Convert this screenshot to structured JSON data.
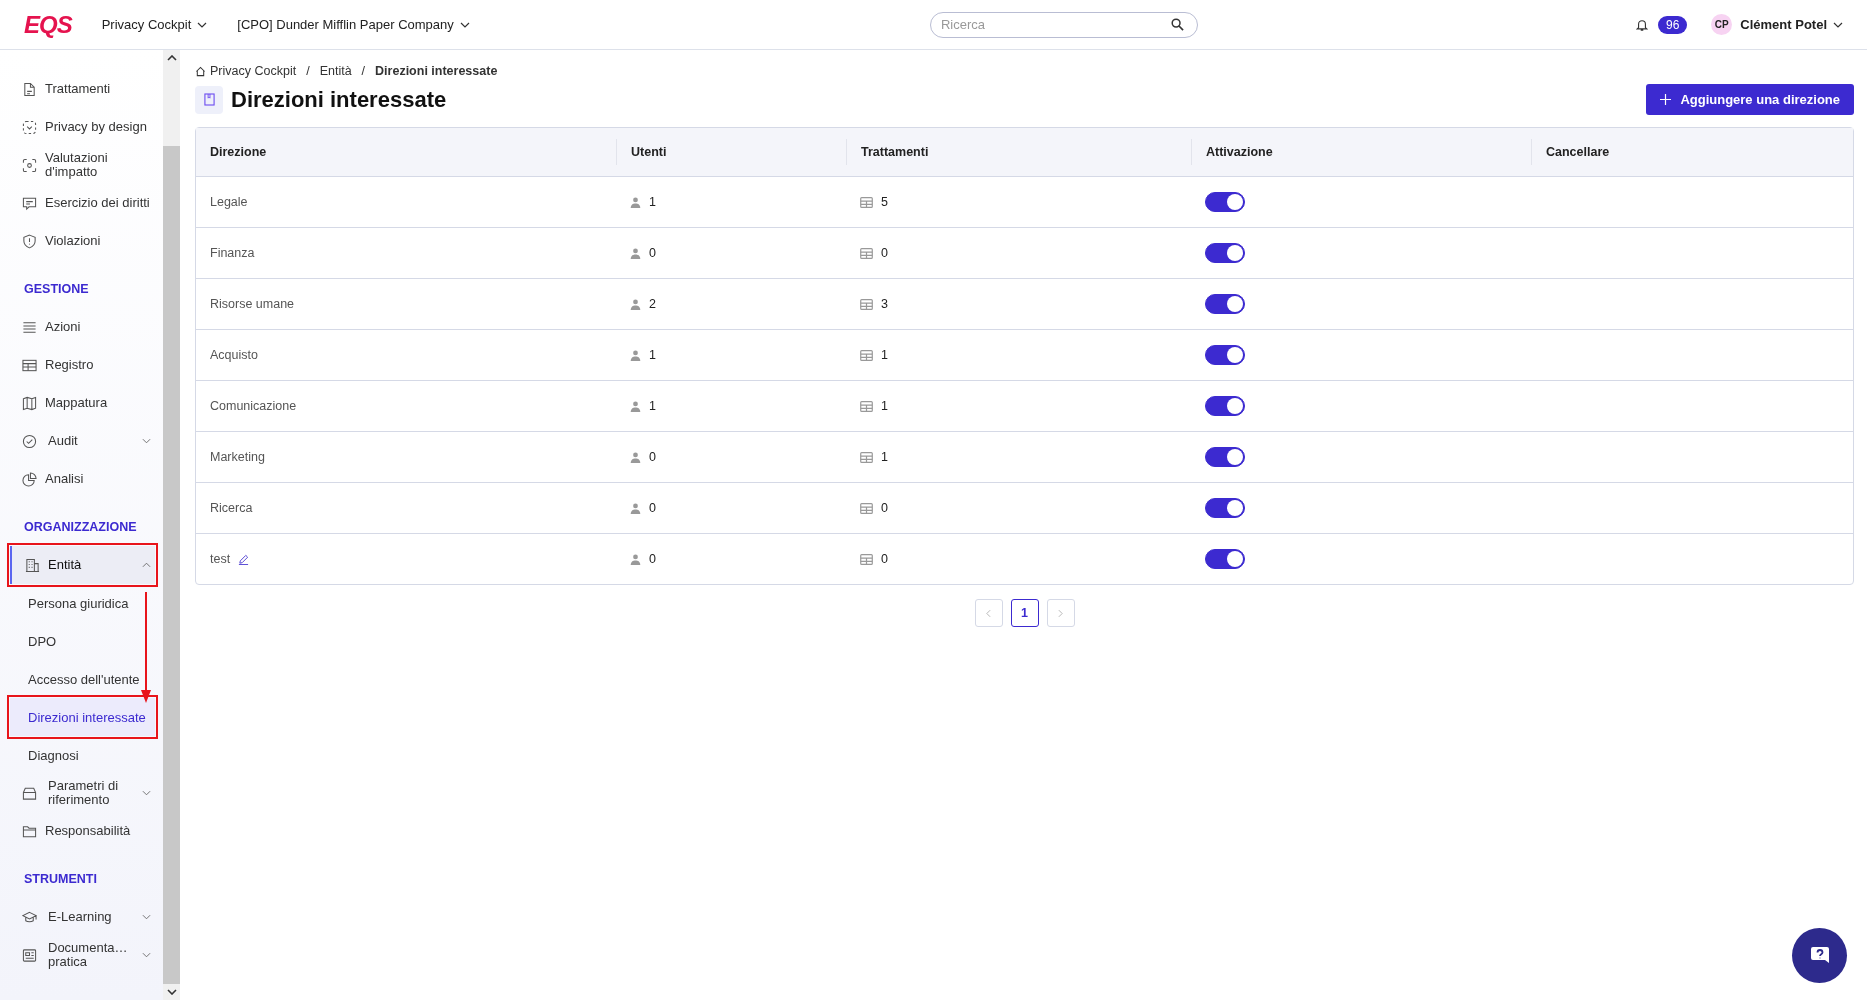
{
  "topbar": {
    "logo": "EQS",
    "menus": [
      {
        "label": "Privacy Cockpit"
      },
      {
        "label": "[CPO] Dunder Mifflin Paper Company"
      }
    ],
    "search": {
      "placeholder": "Ricerca"
    },
    "notifications": "96",
    "user": {
      "initials": "CP",
      "name": "Clément Potel"
    }
  },
  "sidebar": {
    "sections": [
      {
        "items": [
          {
            "label": "Trattamenti",
            "selected": false
          },
          {
            "label": "Privacy by design",
            "selected": false
          },
          {
            "label": "Valutazioni d'impatto",
            "selected": false
          },
          {
            "label": "Esercizio dei diritti",
            "selected": false
          },
          {
            "label": "Violazioni",
            "selected": false
          }
        ]
      },
      {
        "title": "GESTIONE",
        "items": [
          {
            "label": "Azioni",
            "selected": false
          },
          {
            "label": "Registro",
            "selected": false
          },
          {
            "label": "Mappatura",
            "selected": false
          },
          {
            "label": "Audit",
            "selected": false,
            "expanded": false
          },
          {
            "label": "Analisi",
            "selected": false
          }
        ]
      },
      {
        "title": "ORGANIZZAZIONE",
        "items": [
          {
            "label": "Entità",
            "selected": true,
            "highlighted": true,
            "expanded": true,
            "children": [
              {
                "label": "Persona giuridica",
                "selected": false
              },
              {
                "label": "DPO",
                "selected": false
              },
              {
                "label": "Accesso dell'utente",
                "selected": false
              },
              {
                "label": "Direzioni interessate",
                "selected": true,
                "highlighted": true
              },
              {
                "label": "Diagnosi",
                "selected": false
              }
            ]
          },
          {
            "label": "Parametri di riferimento",
            "selected": false,
            "expanded": false
          },
          {
            "label": "Responsabilità",
            "selected": false
          }
        ]
      },
      {
        "title": "STRUMENTI",
        "items": [
          {
            "label": "E-Learning",
            "selected": false,
            "expanded": false
          },
          {
            "label": "Documenta… pratica",
            "selected": false,
            "expanded": false
          }
        ]
      }
    ]
  },
  "breadcrumb": [
    {
      "label": "Privacy Cockpit"
    },
    {
      "separator": "/",
      "label": "Entità"
    },
    {
      "separator": "/",
      "label": "Direzioni interessate"
    }
  ],
  "title": "Direzioni interessate",
  "add_button": "Aggiungere una direzione",
  "table": {
    "columns": [
      "Direzione",
      "Utenti",
      "Trattamenti",
      "Attivazione",
      "Cancellare"
    ],
    "rows": [
      {
        "name": "Legale",
        "users": "1",
        "treatments": "5",
        "on": true
      },
      {
        "name": "Finanza",
        "users": "0",
        "treatments": "0",
        "on": true
      },
      {
        "name": "Risorse umane",
        "users": "2",
        "treatments": "3",
        "on": true
      },
      {
        "name": "Acquisto",
        "users": "1",
        "treatments": "1",
        "on": true
      },
      {
        "name": "Comunicazione",
        "users": "1",
        "treatments": "1",
        "on": true
      },
      {
        "name": "Marketing",
        "users": "0",
        "treatments": "1",
        "on": true
      },
      {
        "name": "Ricerca",
        "users": "0",
        "treatments": "0",
        "on": true
      },
      {
        "name": "test",
        "users": "0",
        "treatments": "0",
        "on": true,
        "editable": true
      }
    ]
  },
  "pagination": {
    "pages": [
      {
        "label": "1",
        "selected": true
      }
    ]
  }
}
